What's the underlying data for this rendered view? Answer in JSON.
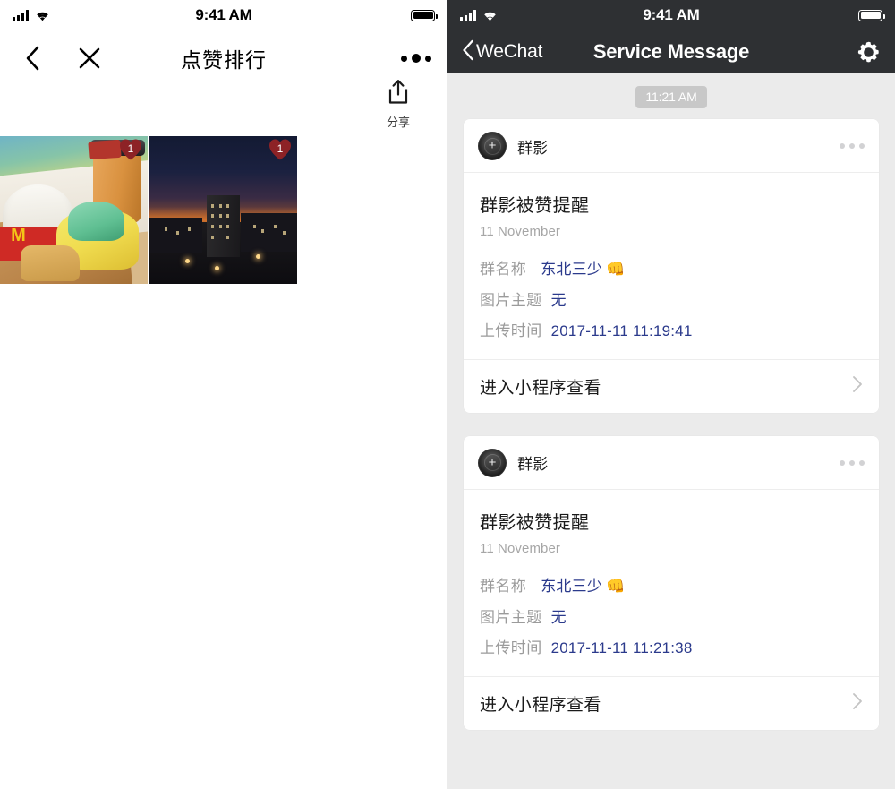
{
  "left_panel": {
    "status_bar": {
      "time": "9:41 AM",
      "signal_icon": "signal-bars-icon",
      "wifi_icon": "wifi-icon",
      "battery_icon": "battery-full-icon"
    },
    "nav": {
      "back_icon": "chevron-left-icon",
      "close_icon": "close-x-icon",
      "title": "点赞排行",
      "more_icon": "more-dots-icon"
    },
    "share": {
      "icon": "share-upload-icon",
      "label": "分享"
    },
    "photos": [
      {
        "alt": "McDonalds meal on tray",
        "badge_count": "1",
        "badge_icon": "heart-badge-icon"
      },
      {
        "alt": "Night cityscape at dusk",
        "badge_count": "1",
        "badge_icon": "heart-badge-icon"
      }
    ]
  },
  "right_panel": {
    "status_bar": {
      "time": "9:41 AM",
      "signal_icon": "signal-bars-icon",
      "wifi_icon": "wifi-icon",
      "battery_icon": "battery-full-icon"
    },
    "nav": {
      "back_icon": "chevron-left-icon",
      "back_label": "WeChat",
      "title": "Service Message",
      "settings_icon": "gear-icon"
    },
    "timestamp_divider": "11:21 AM",
    "messages": [
      {
        "account_name": "群影",
        "avatar_icon": "camera-lens-plus-icon",
        "more_icon": "more-dots-icon",
        "title": "群影被赞提醒",
        "date": "11 November",
        "details": [
          {
            "label": "群名称",
            "value": "东北三少",
            "emoji": "👊"
          },
          {
            "label": "图片主题",
            "value": "无",
            "emoji": ""
          },
          {
            "label": "上传时间",
            "value": "2017-11-11 11:19:41",
            "emoji": ""
          }
        ],
        "footer_label": "进入小程序查看",
        "footer_icon": "chevron-right-icon"
      },
      {
        "account_name": "群影",
        "avatar_icon": "camera-lens-plus-icon",
        "more_icon": "more-dots-icon",
        "title": "群影被赞提醒",
        "date": "11 November",
        "details": [
          {
            "label": "群名称",
            "value": "东北三少",
            "emoji": "👊"
          },
          {
            "label": "图片主题",
            "value": "无",
            "emoji": ""
          },
          {
            "label": "上传时间",
            "value": "2017-11-11 11:21:38",
            "emoji": ""
          }
        ],
        "footer_label": "进入小程序查看",
        "footer_icon": "chevron-right-icon"
      }
    ]
  },
  "colors": {
    "nav_bar_dark": "#2e3033",
    "chat_background": "#ebebeb",
    "card_white": "#ffffff",
    "value_blue": "#2b3a8c",
    "label_gray": "#9b9b9b",
    "badge_red": "#8d2226"
  }
}
